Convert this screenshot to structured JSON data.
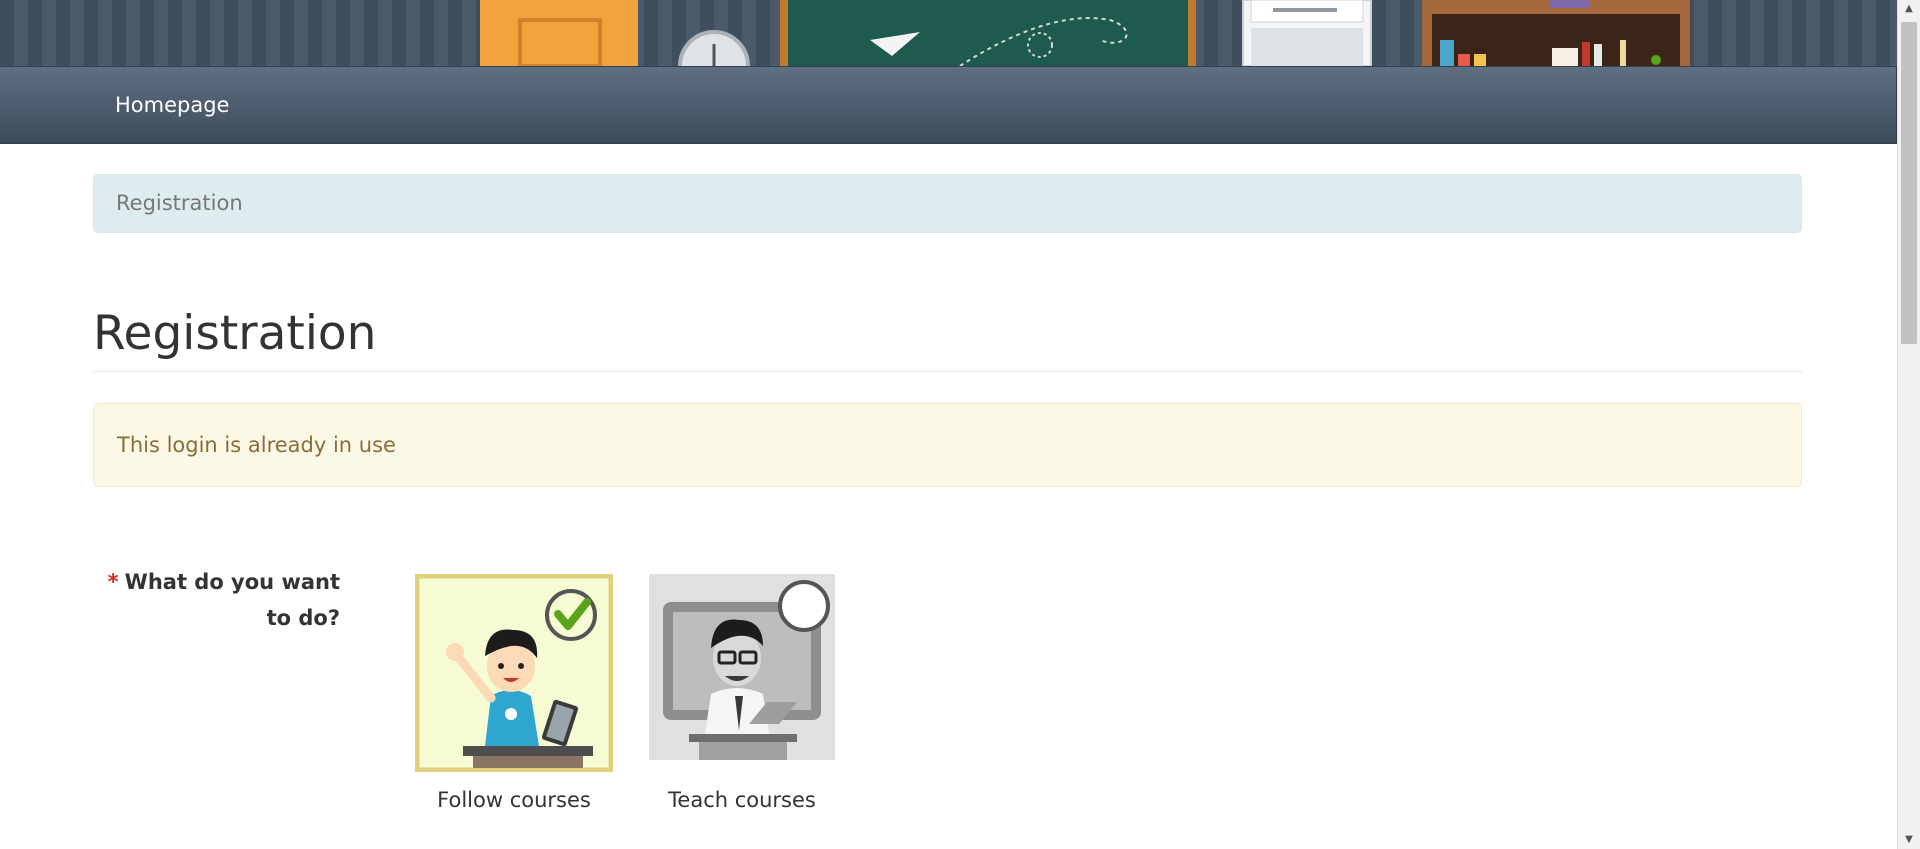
{
  "nav": {
    "home_label": "Homepage"
  },
  "breadcrumb": {
    "current": "Registration"
  },
  "page": {
    "title": "Registration"
  },
  "alert": {
    "message": "This login is already in use",
    "color": "#fcf8e6"
  },
  "form": {
    "question_required_marker": "*",
    "question_label": "What do you want to do?",
    "options": [
      {
        "label": "Follow courses",
        "selected": true,
        "icon": "student-icon"
      },
      {
        "label": "Teach courses",
        "selected": false,
        "icon": "teacher-icon"
      }
    ]
  },
  "colors": {
    "navbar": "#4d5e70",
    "accent_check": "#5aa41c",
    "required": "#d9262a"
  }
}
